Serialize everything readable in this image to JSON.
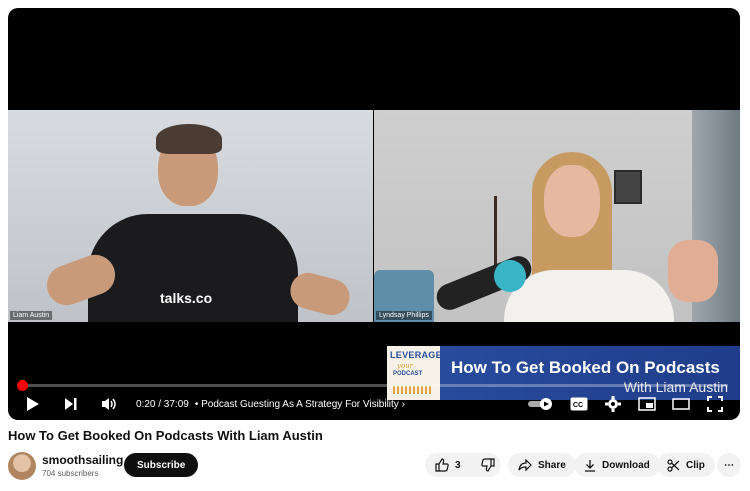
{
  "video": {
    "left_participant_label": "Liam Austin",
    "right_participant_label": "Lyndsay Phillips",
    "left_shirt_logo": "talks.co",
    "title_card": {
      "logo_top": "LEVERAGE",
      "logo_middle": "your",
      "logo_bottom": "PODCAST",
      "title": "How To Get Booked On Podcasts",
      "subtitle": "With Liam Austin"
    }
  },
  "player": {
    "progress_percent": 0.9,
    "time": "0:20 / 37:09",
    "chapter": "• Podcast Guesting As A Strategy For Visibility",
    "controls": {
      "play": "play-icon",
      "next": "next-icon",
      "volume": "volume-icon",
      "autoplay": "autoplay-toggle-icon",
      "captions": "CC",
      "settings": "gear-icon",
      "miniplayer": "miniplayer-icon",
      "theater": "theater-icon",
      "fullscreen": "fullscreen-icon"
    }
  },
  "meta": {
    "title": "How To Get Booked On Podcasts With Liam Austin",
    "channel_name": "smoothsailing",
    "subscribers": "704 subscribers",
    "subscribe_label": "Subscribe",
    "like_count": "3",
    "share_label": "Share",
    "download_label": "Download",
    "clip_label": "Clip",
    "more_label": "⋯"
  }
}
